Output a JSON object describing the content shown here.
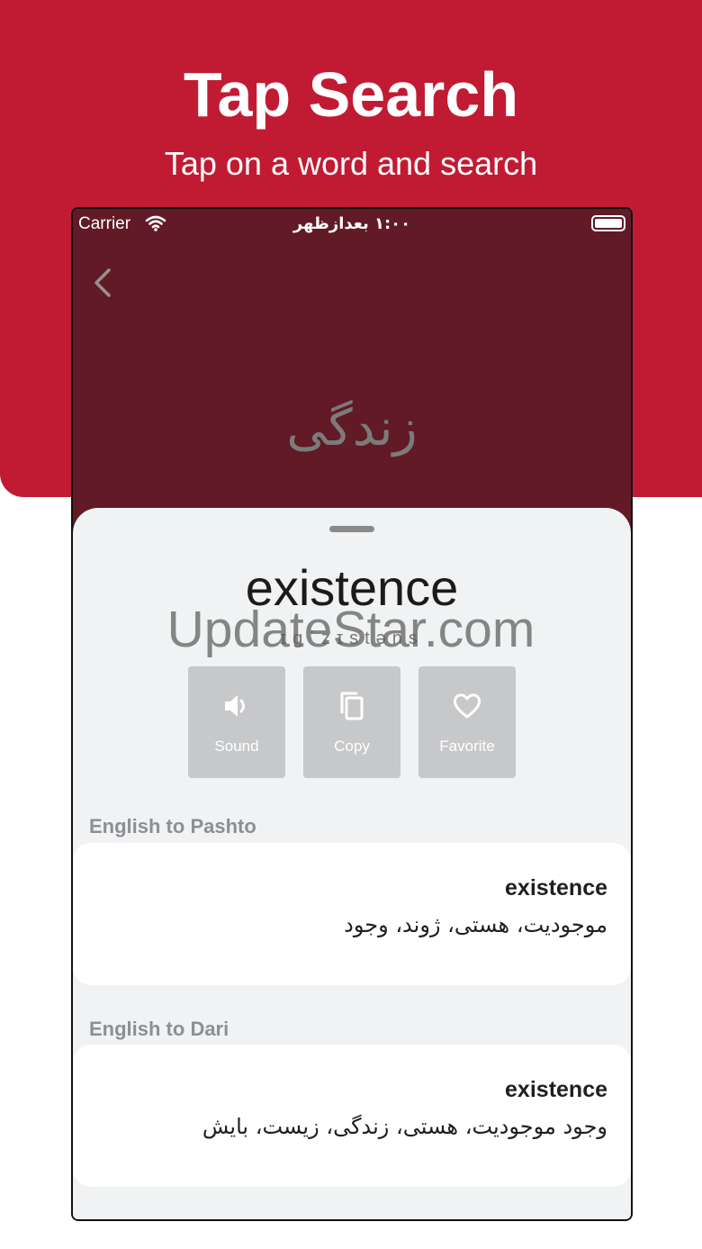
{
  "promo": {
    "title": "Tap Search",
    "subtitle": "Tap on a word and search"
  },
  "status_bar": {
    "carrier": "Carrier",
    "time": "۱:۰۰ بعدازظهر"
  },
  "header": {
    "query_word": "زندگی"
  },
  "entry": {
    "headword": "existence",
    "phonetic": "ɪɡˈzɪstəns"
  },
  "actions": [
    {
      "label": "Sound",
      "icon": "speaker-icon"
    },
    {
      "label": "Copy",
      "icon": "copy-icon"
    },
    {
      "label": "Favorite",
      "icon": "heart-icon"
    }
  ],
  "sections": [
    {
      "title": "English to Pashto",
      "word": "existence",
      "translation": "موجودیت، هستی، ژوند، وجود"
    },
    {
      "title": "English to Dari",
      "word": "existence",
      "translation": "وجود موجودیت، هستی، زندگی، زیست، بایش"
    }
  ],
  "watermark": "UpdateStar.com",
  "colors": {
    "promo_background": "#c11b34",
    "app_header": "#611a26",
    "action_button": "#c7c8ca",
    "sheet_background": "#f1f2f4"
  }
}
